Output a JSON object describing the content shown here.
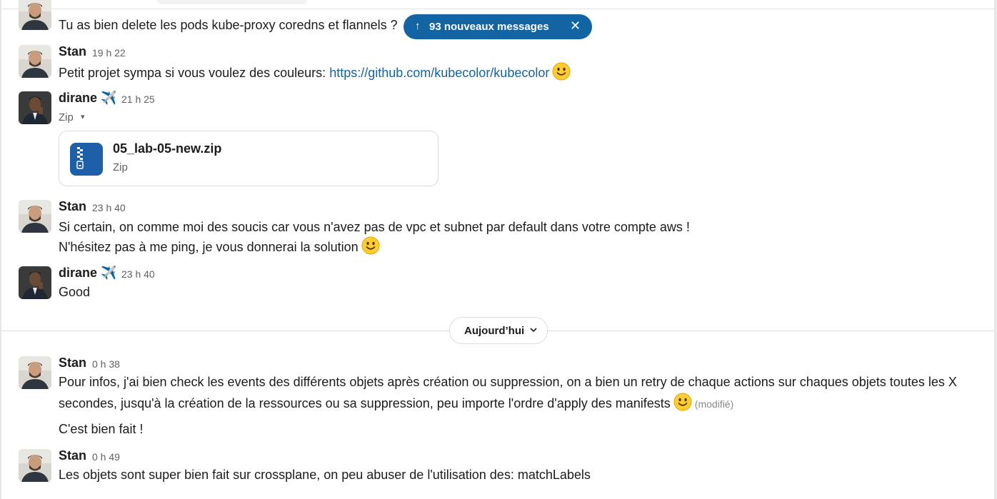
{
  "top_message": {
    "text": "Tu as bien delete les pods kube-proxy coredns et flannels ?"
  },
  "new_messages_banner": {
    "arrow": "↑",
    "label": "93 nouveaux messages",
    "close": "✕"
  },
  "messages": [
    {
      "author": "Stan",
      "time": "19 h 22",
      "text_before_link": "Petit projet sympa si vous voulez des couleurs: ",
      "link": "https://github.com/kubecolor/kubecolor",
      "emoji": "slightly-smiling-face"
    },
    {
      "author": "dirane",
      "status_emoji": "✈️",
      "time": "21 h 25",
      "attachment_type_label": "Zip",
      "attachment_caret": "▾",
      "file": {
        "name": "05_lab-05-new.zip",
        "type": "Zip",
        "icon": "zip-file-icon"
      }
    },
    {
      "author": "Stan",
      "time": "23 h 40",
      "lines": [
        "Si certain, on comme moi des soucis car vous n'avez pas de vpc et subnet par default dans votre compte aws !",
        "N'hésitez pas à me ping, je vous donnerai la solution"
      ],
      "emoji": "slightly-smiling-face"
    },
    {
      "author": "dirane",
      "status_emoji": "✈️",
      "time": "23 h 40",
      "text": "Good"
    },
    {
      "author": "Stan",
      "time": "0 h 38",
      "lines": [
        "Pour infos, j'ai bien check les events des différents objets après création ou suppression, on a bien un retry de chaque actions sur chaques objets toutes les X",
        "secondes, jusqu'à la création de la ressources ou sa suppression, peu importe l'ordre d'apply des manifests"
      ],
      "emoji": "slightly-smiling-face",
      "edited": "(modifié)",
      "followup": "C'est bien fait !"
    },
    {
      "author": "Stan",
      "time": "0 h 49",
      "text": "Les objets sont super bien fait sur crossplane, on peu abuser de l'utilisation des: matchLabels"
    }
  ],
  "day_divider": {
    "label": "Aujourd’hui",
    "caret": "⌄"
  },
  "colors": {
    "accent": "#1264a3",
    "text": "#1d1c1d",
    "muted": "#616061"
  }
}
